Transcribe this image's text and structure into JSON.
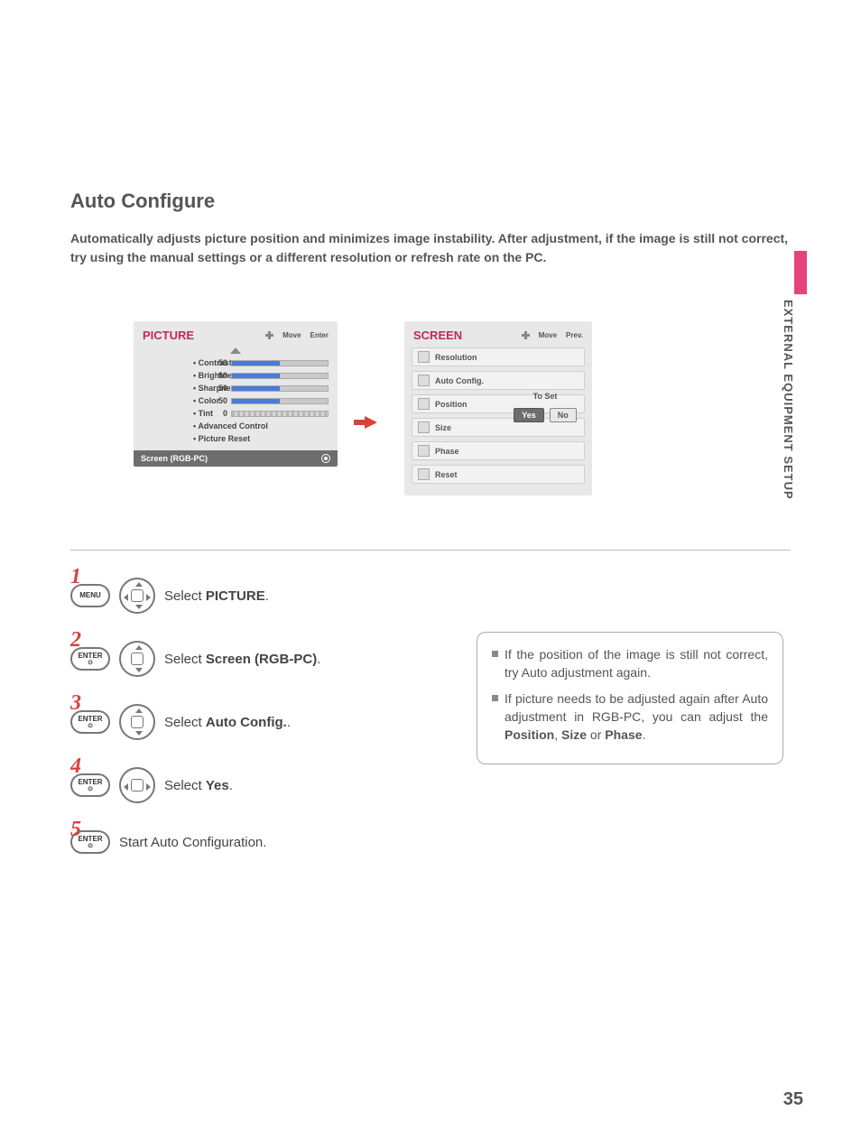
{
  "page": {
    "title": "Auto Configure",
    "intro": "Automatically adjusts picture position and minimizes image instability. After adjustment, if the image is still not correct, try using the manual settings or a different resolution or refresh rate on the PC.",
    "side_label": "EXTERNAL EQUIPMENT SETUP",
    "number": "35"
  },
  "picture_panel": {
    "title": "PICTURE",
    "hint_move": "Move",
    "hint_enter": "Enter",
    "rows": [
      {
        "label": "• Contrast",
        "value": "50",
        "fill": 50
      },
      {
        "label": "• Brightness",
        "value": "50",
        "fill": 50
      },
      {
        "label": "• Sharpness",
        "value": "50",
        "fill": 50
      },
      {
        "label": "• Color",
        "value": "50",
        "fill": 50
      }
    ],
    "tint": {
      "label": "• Tint",
      "value": "0"
    },
    "plain": [
      "• Advanced Control",
      "• Picture Reset"
    ],
    "selected": "Screen (RGB-PC)"
  },
  "screen_panel": {
    "title": "SCREEN",
    "hint_move": "Move",
    "hint_prev": "Prev.",
    "items": [
      "Resolution",
      "Auto Config.",
      "Position",
      "Size",
      "Phase",
      "Reset"
    ],
    "toset": "To Set",
    "yes": "Yes",
    "no": "No"
  },
  "steps": [
    {
      "num": "1",
      "btn": "MENU",
      "dpad": "full",
      "text_pre": "Select ",
      "text_b": "PICTURE",
      "text_post": "."
    },
    {
      "num": "2",
      "btn": "ENTER",
      "dpad": "ud",
      "text_pre": "Select ",
      "text_b": "Screen (RGB-PC)",
      "text_post": "."
    },
    {
      "num": "3",
      "btn": "ENTER",
      "dpad": "ud",
      "text_pre": "Select ",
      "text_b": "Auto Config.",
      "text_post": "."
    },
    {
      "num": "4",
      "btn": "ENTER",
      "dpad": "lr",
      "text_pre": "Select ",
      "text_b": "Yes",
      "text_post": "."
    },
    {
      "num": "5",
      "btn": "ENTER",
      "dpad": "",
      "text_pre": "Start Auto Configuration.",
      "text_b": "",
      "text_post": ""
    }
  ],
  "tips": {
    "t1": "If the position of the image is still not correct, try Auto adjustment again.",
    "t2_a": "If picture needs to be adjusted again after Auto adjustment in RGB-PC, you can adjust the ",
    "t2_b1": "Position",
    "t2_c": ", ",
    "t2_b2": "Size",
    "t2_d": " or ",
    "t2_b3": "Phase",
    "t2_e": "."
  }
}
